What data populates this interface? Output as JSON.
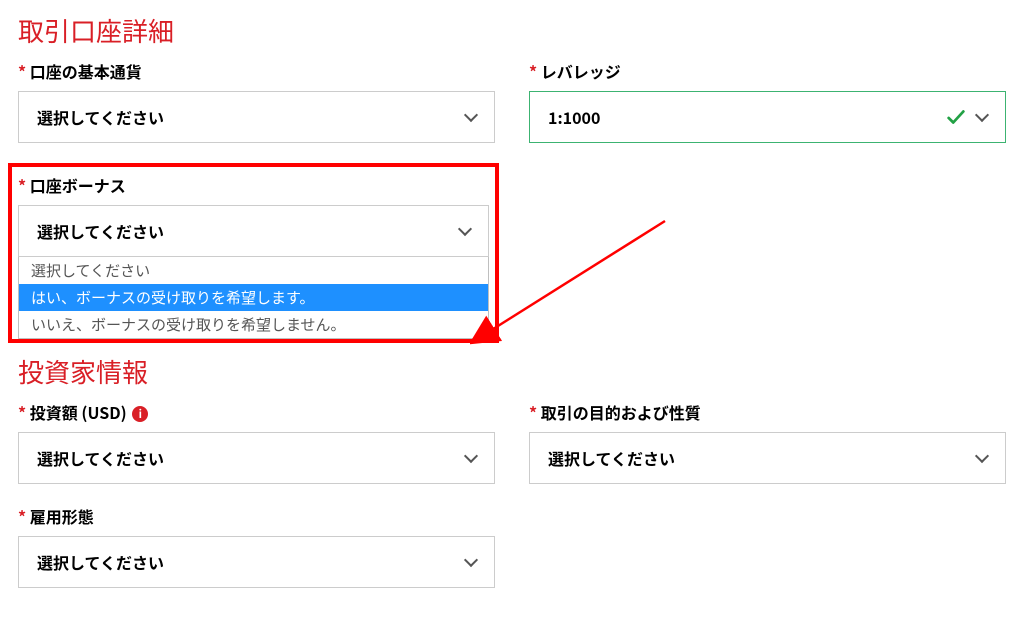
{
  "placeholder": "選択してください",
  "section1": {
    "heading": "取引口座詳細",
    "base_currency": {
      "label": "口座の基本通貨",
      "value": "選択してください"
    },
    "leverage": {
      "label": "レバレッジ",
      "value": "1:1000"
    },
    "bonus": {
      "label": "口座ボーナス",
      "value": "選択してください",
      "options": [
        "選択してください",
        "はい、ボーナスの受け取りを希望します。",
        "いいえ、ボーナスの受け取りを希望しません。"
      ],
      "highlighted_index": 1
    }
  },
  "section2": {
    "heading": "投資家情報",
    "investment_amount": {
      "label": "投資額 (USD)",
      "value": "選択してください"
    },
    "purpose": {
      "label": "取引の目的および性質",
      "value": "選択してください"
    },
    "employment": {
      "label": "雇用形態",
      "value": "選択してください"
    }
  }
}
